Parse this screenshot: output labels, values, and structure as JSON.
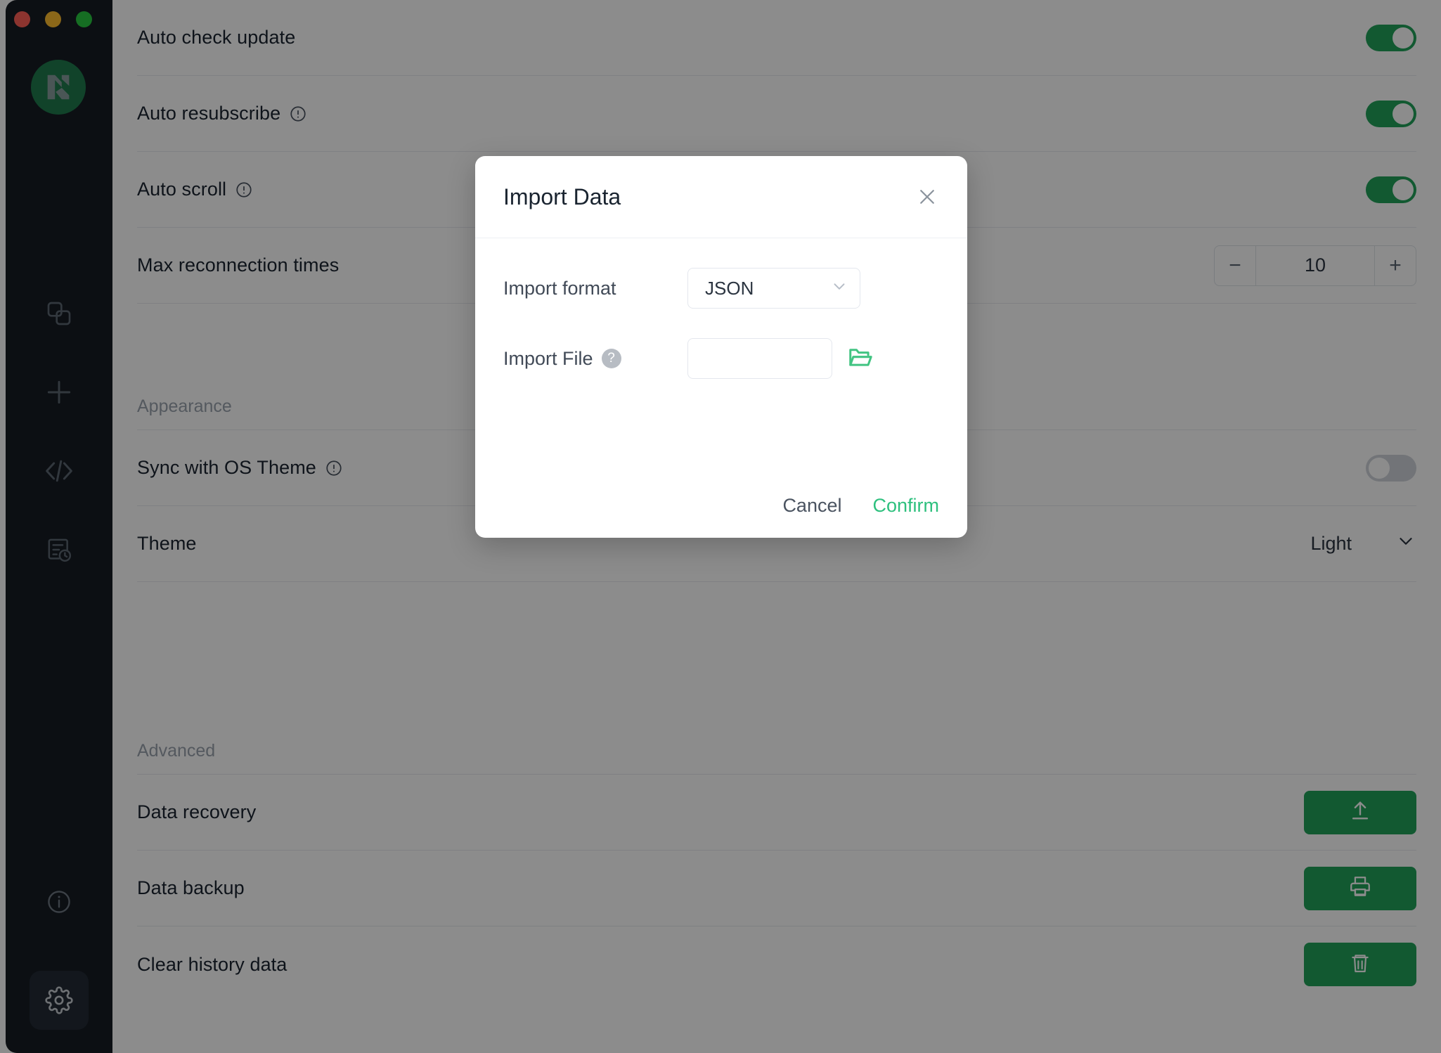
{
  "window": {
    "traffic_lights": [
      "close",
      "minimize",
      "maximize"
    ],
    "brand_icon": "mqttx-logo-icon",
    "colors": {
      "sidebar_bg": "#161c24",
      "brand_green": "#1f7a4d",
      "accent_green": "#21a25a",
      "confirm_green": "#2ec07e"
    }
  },
  "sidebar": {
    "items": [
      {
        "icon": "connections-icon",
        "name": "sidebar-item-connections",
        "active": false
      },
      {
        "icon": "plus-icon",
        "name": "sidebar-item-new-connection",
        "active": false
      },
      {
        "icon": "code-brackets-icon",
        "name": "sidebar-item-scripts",
        "active": false
      },
      {
        "icon": "log-clock-icon",
        "name": "sidebar-item-log",
        "active": false
      }
    ],
    "bottom_items": [
      {
        "icon": "info-circle-icon",
        "name": "sidebar-item-about",
        "active": false
      },
      {
        "icon": "gear-icon",
        "name": "sidebar-item-settings",
        "active": true
      }
    ]
  },
  "settings": {
    "general_rows": [
      {
        "label": "Auto check update",
        "has_info": false,
        "control": "toggle",
        "toggle_on": true
      },
      {
        "label": "Auto resubscribe",
        "has_info": true,
        "control": "toggle",
        "toggle_on": true
      },
      {
        "label": "Auto scroll",
        "has_info": true,
        "control": "toggle",
        "toggle_on": true
      },
      {
        "label": "Max reconnection times",
        "has_info": false,
        "control": "stepper",
        "value": "10",
        "minus": "−",
        "plus": "+"
      }
    ],
    "appearance": {
      "title": "Appearance",
      "rows": [
        {
          "label": "Sync with OS Theme",
          "has_info": true,
          "control": "toggle",
          "toggle_on": false
        },
        {
          "label": "Theme",
          "has_info": false,
          "control": "select",
          "value": "Light"
        }
      ]
    },
    "advanced": {
      "title": "Advanced",
      "rows": [
        {
          "label": "Data recovery",
          "has_info": false,
          "control": "button",
          "icon": "upload-icon"
        },
        {
          "label": "Data backup",
          "has_info": false,
          "control": "button",
          "icon": "printer-icon"
        },
        {
          "label": "Clear history data",
          "has_info": false,
          "control": "button",
          "icon": "trash-icon"
        }
      ]
    }
  },
  "modal": {
    "title": "Import Data",
    "close_icon": "close-icon",
    "format_label": "Import format",
    "format_value": "JSON",
    "format_chevron": "chevron-down-icon",
    "file_label": "Import File",
    "file_help": "?",
    "file_value": "",
    "file_placeholder": "",
    "browse_icon": "folder-open-icon",
    "cancel_label": "Cancel",
    "confirm_label": "Confirm"
  }
}
